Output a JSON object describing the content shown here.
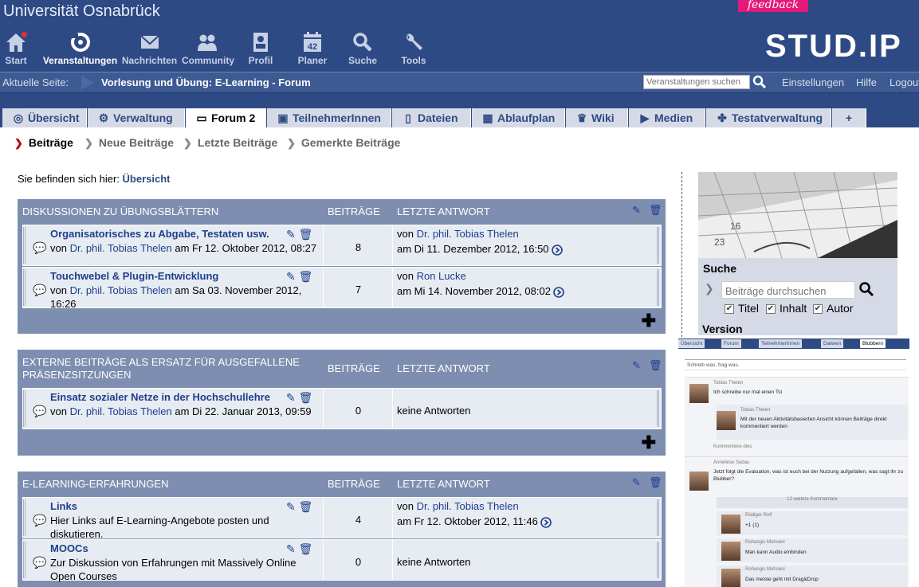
{
  "header": {
    "university": "Universität Osnabrück",
    "feedback": "feedback",
    "brand": "STUD.IP",
    "nav": [
      {
        "label": "Start",
        "icon": "home-icon"
      },
      {
        "label": "Veranstaltungen",
        "icon": "courses-icon",
        "active": true
      },
      {
        "label": "Nachrichten",
        "icon": "envelope-icon"
      },
      {
        "label": "Community",
        "icon": "community-icon"
      },
      {
        "label": "Profil",
        "icon": "profile-icon"
      },
      {
        "label": "Planer",
        "icon": "calendar-icon",
        "badge": "42"
      },
      {
        "label": "Suche",
        "icon": "search-icon"
      },
      {
        "label": "Tools",
        "icon": "wrench-icon"
      }
    ]
  },
  "crumbbar": {
    "label": "Aktuelle Seite:",
    "title": "Vorlesung und Übung: E-Learning - Forum",
    "search_placeholder": "Veranstaltungen suchen",
    "links": [
      "Einstellungen",
      "Hilfe",
      "Logout"
    ]
  },
  "tabs": [
    {
      "label": "Übersicht",
      "icon": "overview-icon"
    },
    {
      "label": "Verwaltung",
      "icon": "gears-icon"
    },
    {
      "label": "Forum 2",
      "icon": "forum-icon",
      "active": true
    },
    {
      "label": "TeilnehmerInnen",
      "icon": "participants-icon"
    },
    {
      "label": "Dateien",
      "icon": "files-icon"
    },
    {
      "label": "Ablaufplan",
      "icon": "schedule-icon"
    },
    {
      "label": "Wiki",
      "icon": "wiki-icon"
    },
    {
      "label": "Medien",
      "icon": "media-icon"
    },
    {
      "label": "Testatverwaltung",
      "icon": "puzzle-icon"
    },
    {
      "label": "+",
      "icon": ""
    }
  ],
  "subnav": [
    "Beiträge",
    "Neue Beiträge",
    "Letzte Beiträge",
    "Gemerkte Beiträge"
  ],
  "location": {
    "prefix": "Sie befinden sich hier:",
    "current": "Übersicht"
  },
  "columns": {
    "posts": "BEITRÄGE",
    "last": "LETZTE ANTWORT"
  },
  "categories": [
    {
      "title": "DISKUSSIONEN ZU ÜBUNGSBLÄTTERN",
      "areas": [
        {
          "title": "Organisatorisches zu Abgabe, Testaten usw.",
          "by": "von",
          "author": "Dr. phil. Tobias Thelen",
          "date": "am Fr 12. Oktober 2012, 08:27",
          "count": "8",
          "last_by": "von",
          "last_author": "Dr. phil. Tobias Thelen",
          "last_date": "am Di 11. Dezember 2012, 16:50"
        },
        {
          "title": "Touchwebel & Plugin-Entwicklung",
          "by": "von",
          "author": "Dr. phil. Tobias Thelen",
          "date": "am Sa 03. November 2012, 16:26",
          "count": "7",
          "last_by": "von",
          "last_author": "Ron Lucke",
          "last_date": "am Mi 14. November 2012, 08:02"
        }
      ]
    },
    {
      "title": "EXTERNE BEITRÄGE ALS ERSATZ FÜR AUSGEFALLENE PRÄSENZSITZUNGEN",
      "areas": [
        {
          "title": "Einsatz sozialer Netze in der Hochschullehre",
          "by": "von",
          "author": "Dr. phil. Tobias Thelen",
          "date": "am Di 22. Januar 2013, 09:59",
          "count": "0",
          "no_answers": "keine Antworten"
        }
      ]
    },
    {
      "title": "E-LEARNING-ERFAHRUNGEN",
      "areas": [
        {
          "title": "Links",
          "desc": "Hier Links auf E-Learning-Angebote posten und diskutieren.",
          "count": "4",
          "last_by": "von",
          "last_author": "Dr. phil. Tobias Thelen",
          "last_date": "am Fr 12. Oktober 2012, 11:46"
        },
        {
          "title": "MOOCs",
          "desc": "Zur Diskussion von Erfahrungen mit Massively Online Open Courses",
          "count": "0",
          "no_answers": "keine Antworten"
        }
      ]
    }
  ],
  "sidebar": {
    "search_title": "Suche",
    "search_placeholder": "Beiträge durchsuchen",
    "checks": [
      "Titel",
      "Inhalt",
      "Autor"
    ],
    "version_title": "Version"
  },
  "mini": {
    "tabs": [
      "Übersicht",
      "Forum",
      "TeilnehmerInnen",
      "Dateien",
      "Blubbern"
    ],
    "input": "Schreib was, frag was.",
    "posts": [
      {
        "name": "Tobias Thelen",
        "text": "Ich schreibe nur mal einen Tst"
      },
      {
        "name": "Tobias Thelen",
        "text": "Mit der neuen Aktivitätsbasierten Ansicht können Beiträge direkt kommentiert werden"
      },
      {
        "name": "Kommentiere dies",
        "text": ""
      },
      {
        "name": "Anneliese Sadau",
        "text": "Jetzt folgt die Evaluation, was ist euch bei der Nutzung aufgefallen, was sagt ihr zu Blubber?"
      },
      {
        "name": "12 weitere Kommentare",
        "text": ""
      },
      {
        "name": "Rüdiger Rolf",
        "text": "+1 (1)"
      },
      {
        "name": "Rohangis Mohseni",
        "text": "Man kann Audio einbinden"
      },
      {
        "name": "Rohangis Mohseni",
        "text": "Das meiste geht mit Drag&Drop"
      }
    ]
  }
}
